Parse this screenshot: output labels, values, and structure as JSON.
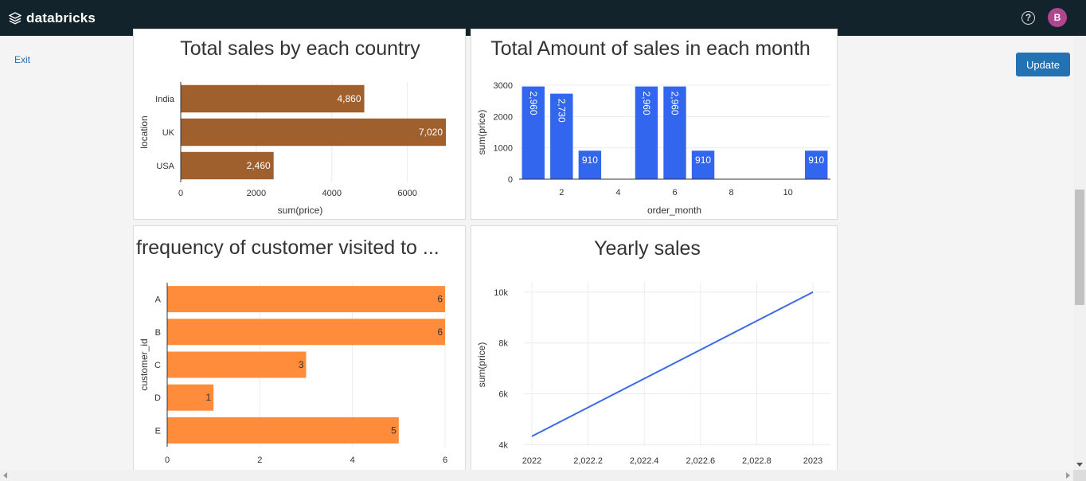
{
  "header": {
    "brand": "databricks",
    "help_icon": "question-circle-icon",
    "avatar_initial": "B",
    "avatar_color": "#b04690"
  },
  "sidebar": {
    "exit_label": "Exit"
  },
  "toolbar": {
    "update_label": "Update"
  },
  "colors": {
    "topbar": "#13232b",
    "accent": "#2272b4"
  },
  "chart_data": [
    {
      "id": "country",
      "type": "bar",
      "orientation": "horizontal",
      "title": "Total sales by each country",
      "xlabel": "sum(price)",
      "ylabel": "location",
      "categories": [
        "India",
        "UK",
        "USA"
      ],
      "values": [
        4860,
        7020,
        2460
      ],
      "data_labels": [
        "4,860",
        "7,020",
        "2,460"
      ],
      "xlim": [
        0,
        7020
      ],
      "xticks": [
        0,
        2000,
        4000,
        6000
      ],
      "color": "#a0602e",
      "grid": true
    },
    {
      "id": "month",
      "type": "bar",
      "orientation": "vertical",
      "title": "Total Amount of sales in each month",
      "xlabel": "order_month",
      "ylabel": "sum(price)",
      "x": [
        1,
        2,
        3,
        5,
        6,
        7,
        11
      ],
      "values": [
        2960,
        2730,
        910,
        2960,
        2960,
        910,
        910
      ],
      "data_labels": [
        "2,960",
        "2,730",
        "910",
        "2,960",
        "2,960",
        "910",
        "910"
      ],
      "xlim": [
        0.5,
        11.5
      ],
      "ylim": [
        0,
        3000
      ],
      "xticks": [
        2,
        4,
        6,
        8,
        10
      ],
      "yticks": [
        0,
        1000,
        2000,
        3000
      ],
      "color": "#3366ee",
      "grid": true
    },
    {
      "id": "customer",
      "type": "bar",
      "orientation": "horizontal",
      "title": "frequency of customer visited to ...",
      "xlabel": "",
      "ylabel": "customer_id",
      "categories": [
        "A",
        "B",
        "C",
        "D",
        "E"
      ],
      "values": [
        6,
        6,
        3,
        1,
        5
      ],
      "data_labels": [
        "6",
        "6",
        "3",
        "1",
        "5"
      ],
      "xlim": [
        0,
        6
      ],
      "xticks": [
        0,
        2,
        4,
        6
      ],
      "color": "#ff8c3a",
      "grid": true
    },
    {
      "id": "yearly",
      "type": "line",
      "title": "Yearly sales",
      "xlabel": "",
      "ylabel": "sum(price)",
      "x": [
        2022,
        2023
      ],
      "values": [
        4330,
        10000
      ],
      "xlim": [
        2022,
        2023
      ],
      "ylim": [
        3950,
        10400
      ],
      "xticks": [
        2022,
        2022.2,
        2022.4,
        2022.6,
        2022.8,
        2023
      ],
      "xtick_labels": [
        "2022",
        "2,022.2",
        "2,022.4",
        "2,022.6",
        "2,022.8",
        "2023"
      ],
      "yticks": [
        4000,
        6000,
        8000,
        10000
      ],
      "ytick_labels": [
        "4k",
        "6k",
        "8k",
        "10k"
      ],
      "color": "#3d6be6",
      "grid": true
    }
  ]
}
